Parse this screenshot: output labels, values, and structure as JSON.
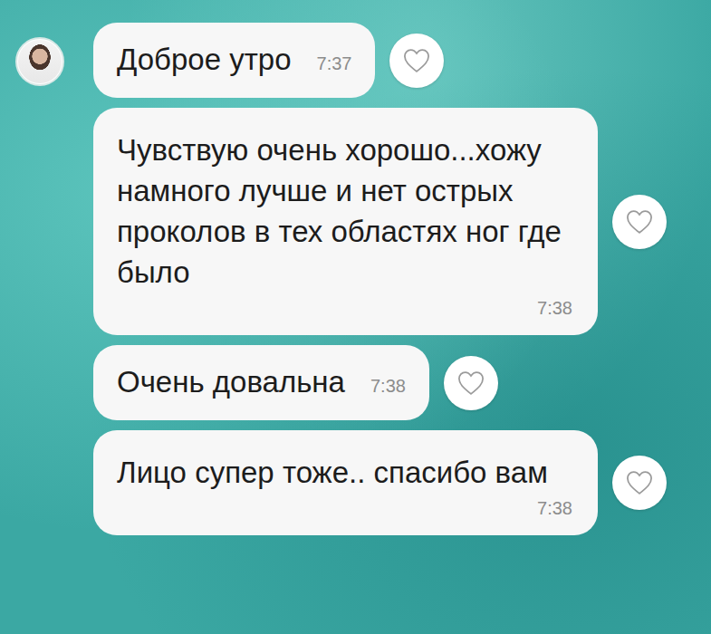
{
  "chat": {
    "messages": [
      {
        "text": "Доброе утро",
        "time": "7:37",
        "kind": "short",
        "liked": false,
        "avatar": true
      },
      {
        "text": "Чувствую очень хорошо...хожу намного лучше и нет острых проколов в тех областях ног где было",
        "time": "7:38",
        "kind": "long",
        "liked": false,
        "avatar": false
      },
      {
        "text": "Очень довальна",
        "time": "7:38",
        "kind": "short",
        "liked": false,
        "avatar": false
      },
      {
        "text": "Лицо супер тоже.. спасибо вам",
        "time": "7:38",
        "kind": "long",
        "liked": false,
        "avatar": false
      }
    ]
  }
}
